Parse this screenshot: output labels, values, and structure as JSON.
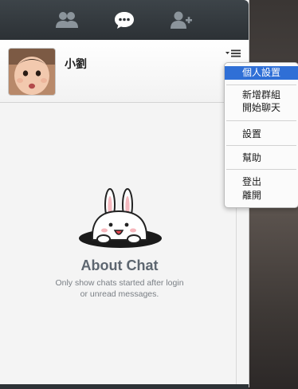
{
  "toolbar": {
    "tabs": [
      {
        "name": "friends",
        "icon": "friends-icon"
      },
      {
        "name": "chats",
        "icon": "chat-bubble-icon",
        "active": true
      },
      {
        "name": "add-friend",
        "icon": "add-friend-icon"
      }
    ],
    "colors": {
      "background": "#2c3135",
      "icon": "#8b949b",
      "active_icon": "#ffffff"
    }
  },
  "profile": {
    "name": "小劉",
    "menu_icon": "menu-list-icon"
  },
  "empty_state": {
    "title": "About Chat",
    "description_line1": "Only show chats started after login",
    "description_line2": "or unread messages.",
    "illustration": "cony-rabbit-mascot"
  },
  "dropdown_menu": {
    "items": [
      {
        "label": "個人設置",
        "selected": true
      },
      {
        "label": "新增群組"
      },
      {
        "label": "開始聊天"
      },
      {
        "label": "設置"
      },
      {
        "label": "幫助"
      },
      {
        "label": "登出"
      },
      {
        "label": "離開"
      }
    ],
    "selected_color": "#2f6fd6"
  }
}
